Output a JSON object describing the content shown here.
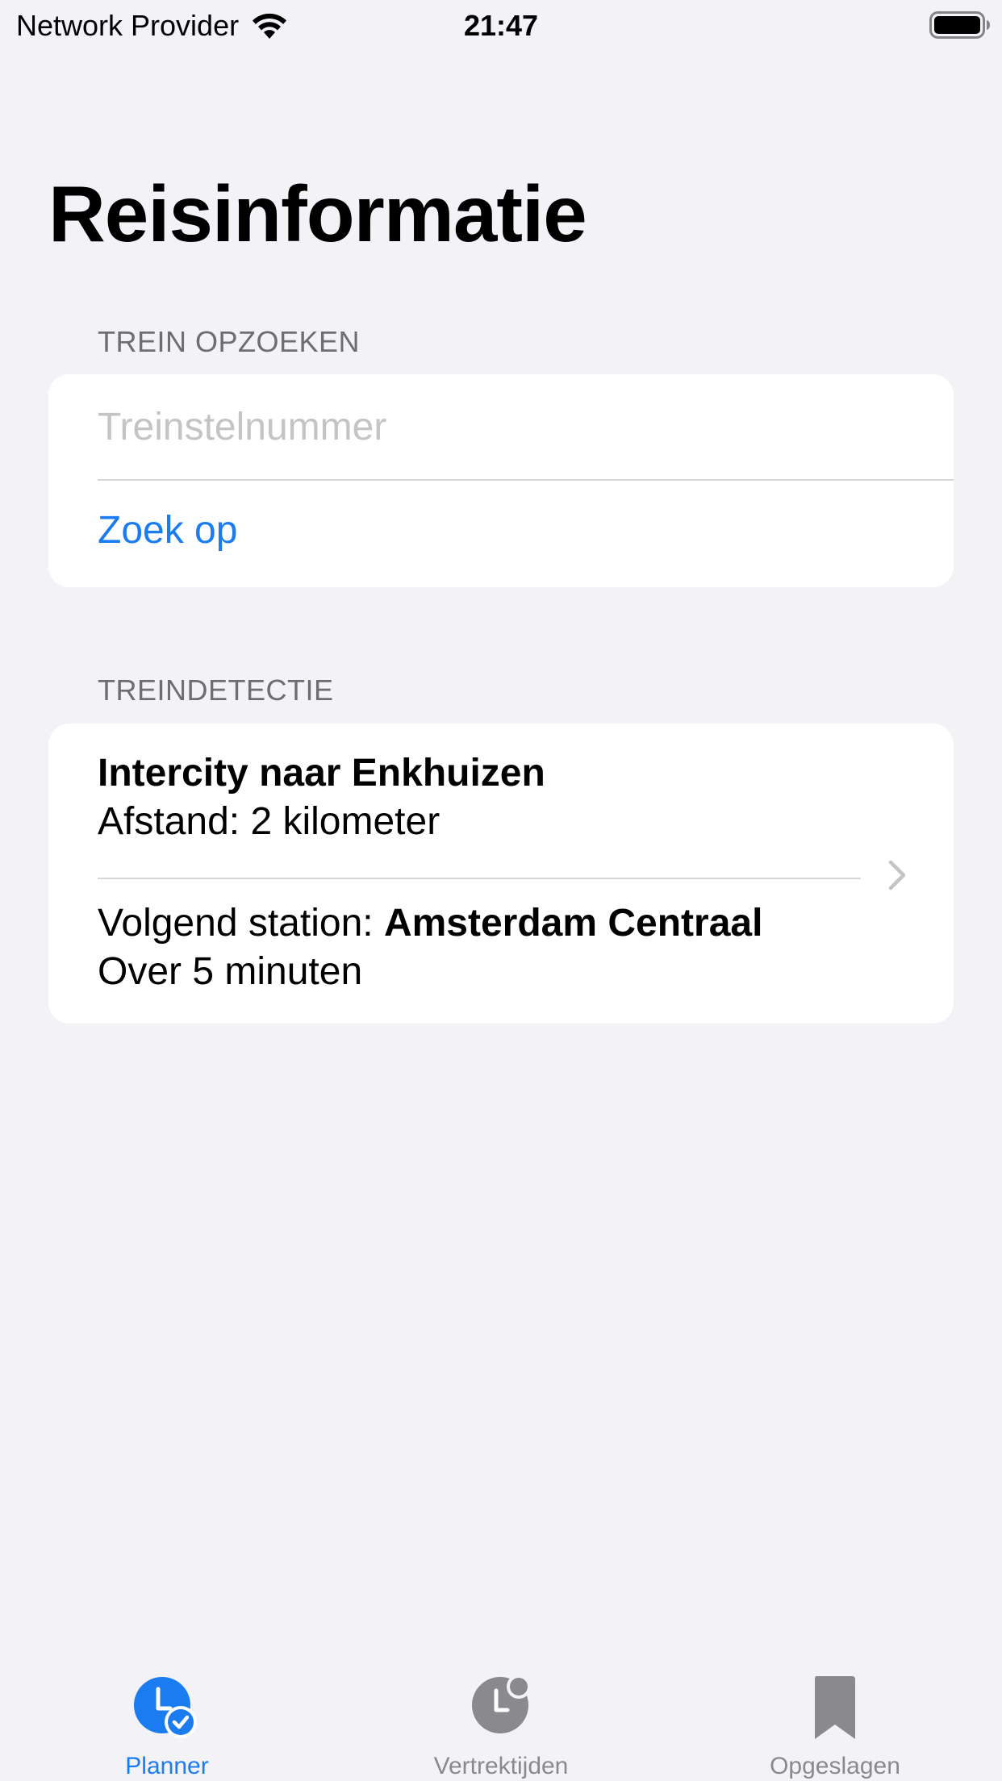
{
  "status_bar": {
    "carrier": "Network Provider",
    "time": "21:47"
  },
  "page": {
    "title": "Reisinformatie"
  },
  "lookup": {
    "header": "TREIN OPZOEKEN",
    "placeholder": "Treinstelnummer",
    "value": "",
    "button_label": "Zoek op"
  },
  "detection": {
    "header": "TREINDETECTIE",
    "train_name": "Intercity naar Enkhuizen",
    "distance": "Afstand: 2 kilometer",
    "next_station_prefix": "Volgend station: ",
    "next_station": "Amsterdam Centraal",
    "eta": "Over 5 minuten"
  },
  "tabs": [
    {
      "label": "Planner",
      "icon": "clock-checkmark-icon",
      "active": true
    },
    {
      "label": "Vertrektijden",
      "icon": "clock-badge-icon",
      "active": false
    },
    {
      "label": "Opgeslagen",
      "icon": "bookmark-icon",
      "active": false
    }
  ],
  "colors": {
    "accent": "#1a7cf0",
    "inactive": "#8a8a8e",
    "background": "#f2f2f7",
    "card": "#ffffff"
  }
}
